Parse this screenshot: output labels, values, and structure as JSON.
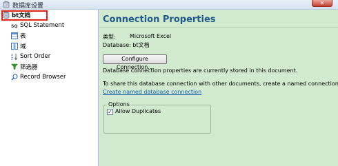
{
  "window": {
    "title": "数据库设置",
    "close_glyph": "✕"
  },
  "sidebar": {
    "root": {
      "label": "bt文档",
      "icon": "database-icon"
    },
    "items": [
      {
        "label": "SQL Statement",
        "icon": "sql-icon"
      },
      {
        "label": "表",
        "icon": "table-icon"
      },
      {
        "label": "域",
        "icon": "field-icon"
      },
      {
        "label": "Sort Order",
        "icon": "sort-icon"
      },
      {
        "label": "筛选器",
        "icon": "filter-icon"
      },
      {
        "label": "Record Browser",
        "icon": "search-icon"
      }
    ]
  },
  "main": {
    "heading": "Connection Properties",
    "type_label": "类型:",
    "type_value": "Microsoft Excel",
    "database_text": "Database: bt文档",
    "configure_button": "Configure Connection...",
    "stored_text": "Database connection properties are currently stored in this document.",
    "share_text": "To share this database connection with other documents, create a named connection.",
    "create_link": "Create named database connection",
    "options": {
      "legend": "Options",
      "allow_duplicates_label": "Allow Duplicates",
      "allow_duplicates_checked": true,
      "check_glyph": "✓"
    }
  },
  "colors": {
    "heading": "#1f5a8c",
    "panel": "#d2ebd0",
    "link": "#1a5db0",
    "selection_outline": "#e2231a"
  }
}
